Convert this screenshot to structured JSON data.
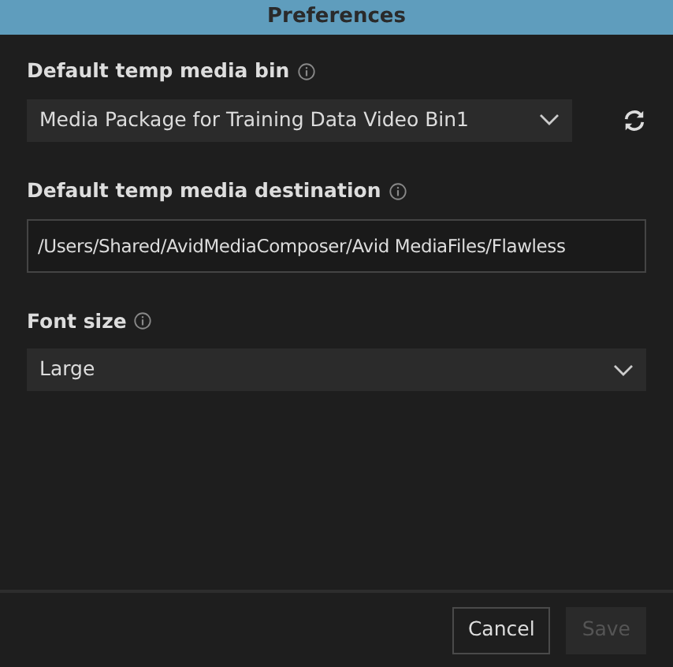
{
  "window": {
    "title": "Preferences"
  },
  "fields": [
    {
      "kind": "select",
      "label": "Default temp media bin",
      "value": "Media Package for Training Data Video Bin1",
      "refresh": true
    },
    {
      "kind": "input",
      "label": "Default temp media destination",
      "value": "/Users/Shared/AvidMediaComposer/Avid MediaFiles/Flawless"
    },
    {
      "kind": "select",
      "label": "Font size",
      "value": "Large",
      "refresh": false
    }
  ],
  "buttons": [
    {
      "label": "Cancel",
      "disabled": false
    },
    {
      "label": "Save",
      "disabled": true
    }
  ]
}
